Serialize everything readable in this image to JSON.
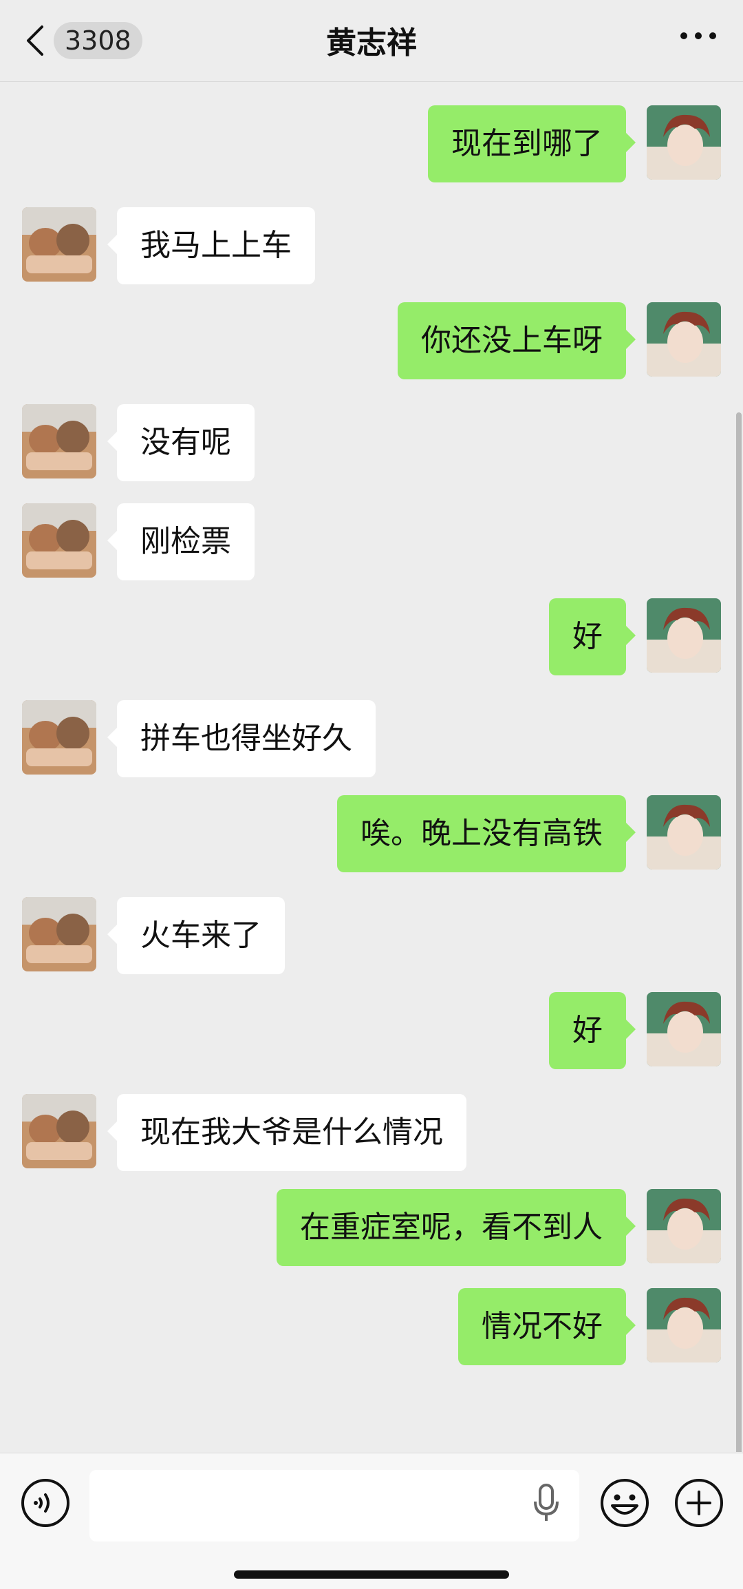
{
  "header": {
    "unread_count": "3308",
    "title": "黄志祥"
  },
  "messages": [
    {
      "side": "out",
      "text": "现在到哪了"
    },
    {
      "side": "in",
      "text": "我马上上车"
    },
    {
      "side": "out",
      "text": "你还没上车呀"
    },
    {
      "side": "in",
      "text": "没有呢"
    },
    {
      "side": "in",
      "text": "刚检票"
    },
    {
      "side": "out",
      "text": "好"
    },
    {
      "side": "in",
      "text": "拼车也得坐好久"
    },
    {
      "side": "out",
      "text": "唉。晚上没有高铁"
    },
    {
      "side": "in",
      "text": "火车来了"
    },
    {
      "side": "out",
      "text": "好"
    },
    {
      "side": "in",
      "text": "现在我大爷是什么情况"
    },
    {
      "side": "out",
      "text": "在重症室呢，看不到人"
    },
    {
      "side": "out",
      "text": "情况不好"
    }
  ],
  "input": {
    "value": ""
  },
  "colors": {
    "outgoing_bubble": "#95ec69",
    "incoming_bubble": "#ffffff",
    "background": "#ededed"
  },
  "icons": {
    "back": "chevron-left-icon",
    "more": "more-horizontal-icon",
    "voice": "voice-icon",
    "mic": "microphone-icon",
    "emoji": "emoji-icon",
    "plus": "plus-icon"
  }
}
